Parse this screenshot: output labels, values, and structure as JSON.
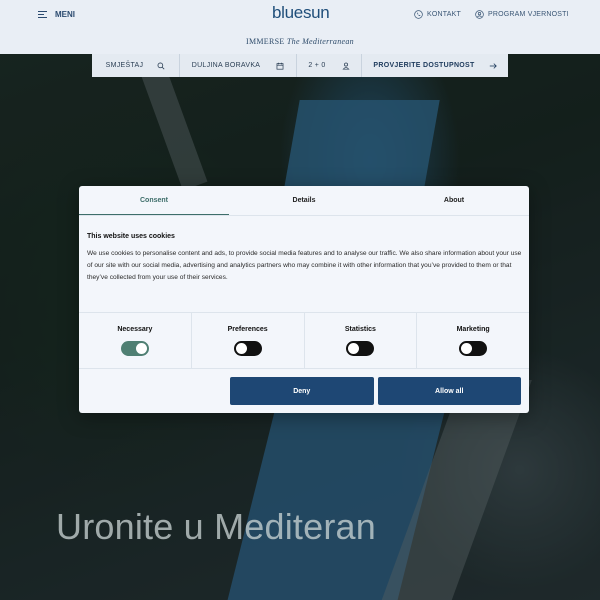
{
  "header": {
    "menu_label": "MENI",
    "logo": "bluesun",
    "contact_label": "KONTAKT",
    "loyalty_label": "PROGRAM VJERNOSTI",
    "tagline_prefix": "IMMERSE",
    "tagline_suffix": "The Mediterranean"
  },
  "booking": {
    "accommodation": "SMJEŠTAJ",
    "duration": "DULJINA BORAVKA",
    "guests": "2 + 0",
    "cta": "PROVJERITE DOSTUPNOST"
  },
  "hero": {
    "title": "Uronite u Mediteran"
  },
  "consent": {
    "tabs": [
      "Consent",
      "Details",
      "About"
    ],
    "active_tab": "Consent",
    "title": "This website uses cookies",
    "text": "We use cookies to personalise content and ads, to provide social media features and to analyse our traffic. We also share information about your use of our site with our social media, advertising and analytics partners who may combine it with other information that you’ve provided to them or that they’ve collected from your use of their services.",
    "toggles": [
      {
        "label": "Necessary",
        "on": true
      },
      {
        "label": "Preferences",
        "on": false
      },
      {
        "label": "Statistics",
        "on": false
      },
      {
        "label": "Marketing",
        "on": false
      }
    ],
    "deny_label": "Deny",
    "allow_label": "Allow all"
  },
  "colors": {
    "brand": "#1f4e7a",
    "button": "#1e4774",
    "toggle_on": "#4f7f73",
    "active_tab": "#3e6e6a"
  },
  "icons": {
    "menu": "hamburger-icon",
    "contact": "phone-icon",
    "loyalty": "user-circle-icon",
    "search": "search-icon",
    "calendar": "calendar-icon",
    "guests": "person-icon",
    "arrow": "arrow-right-icon"
  }
}
